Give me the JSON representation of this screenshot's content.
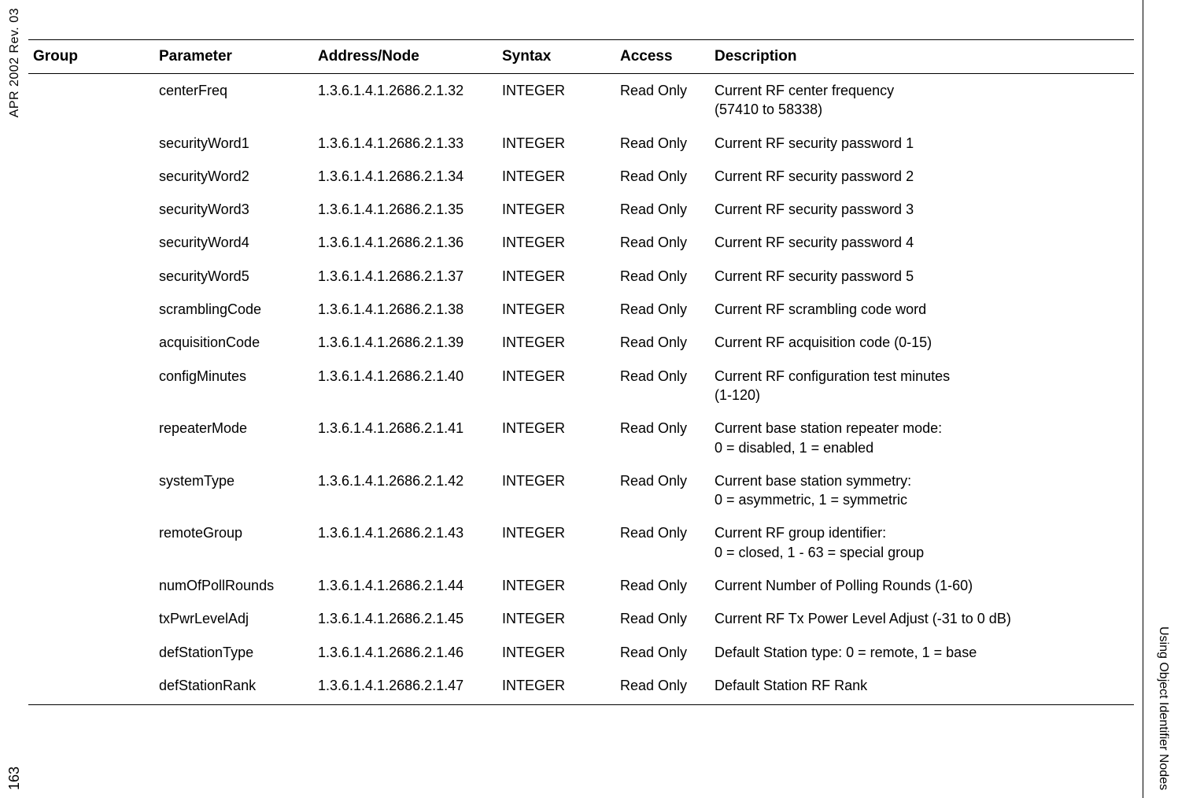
{
  "margin_left_top": "APR 2002 Rev. 03",
  "margin_left_bottom": "163",
  "margin_right": "Using Object Identifier Nodes",
  "chart_data": {
    "type": "table",
    "title": "",
    "columns": [
      "Group",
      "Parameter",
      "Address/Node",
      "Syntax",
      "Access",
      "Description"
    ]
  },
  "headers": {
    "group": "Group",
    "parameter": "Parameter",
    "address": "Address/Node",
    "syntax": "Syntax",
    "access": "Access",
    "description": "Description"
  },
  "rows": [
    {
      "group": "",
      "parameter": "centerFreq",
      "address": "1.3.6.1.4.1.2686.2.1.32",
      "syntax": "INTEGER",
      "access": "Read Only",
      "description": "Current RF center frequency\n (57410 to 58338)"
    },
    {
      "group": "",
      "parameter": "securityWord1",
      "address": "1.3.6.1.4.1.2686.2.1.33",
      "syntax": "INTEGER",
      "access": "Read Only",
      "description": "Current RF security password 1"
    },
    {
      "group": "",
      "parameter": "securityWord2",
      "address": "1.3.6.1.4.1.2686.2.1.34",
      "syntax": "INTEGER",
      "access": "Read Only",
      "description": "Current RF security password 2"
    },
    {
      "group": "",
      "parameter": "securityWord3",
      "address": "1.3.6.1.4.1.2686.2.1.35",
      "syntax": "INTEGER",
      "access": "Read Only",
      "description": "Current RF security password 3"
    },
    {
      "group": "",
      "parameter": "securityWord4",
      "address": "1.3.6.1.4.1.2686.2.1.36",
      "syntax": "INTEGER",
      "access": "Read Only",
      "description": "Current RF security password 4"
    },
    {
      "group": "",
      "parameter": "securityWord5",
      "address": "1.3.6.1.4.1.2686.2.1.37",
      "syntax": "INTEGER",
      "access": "Read Only",
      "description": "Current RF security password 5"
    },
    {
      "group": "",
      "parameter": "scramblingCode",
      "address": "1.3.6.1.4.1.2686.2.1.38",
      "syntax": "INTEGER",
      "access": "Read Only",
      "description": "Current RF scrambling code word"
    },
    {
      "group": "",
      "parameter": "acquisitionCode",
      "address": "1.3.6.1.4.1.2686.2.1.39",
      "syntax": "INTEGER",
      "access": "Read Only",
      "description": "Current RF acquisition code (0-15)"
    },
    {
      "group": "",
      "parameter": "configMinutes",
      "address": "1.3.6.1.4.1.2686.2.1.40",
      "syntax": "INTEGER",
      "access": "Read Only",
      "description": "Current RF configuration test minutes\n (1-120)"
    },
    {
      "group": "",
      "parameter": "repeaterMode",
      "address": "1.3.6.1.4.1.2686.2.1.41",
      "syntax": "INTEGER",
      "access": "Read Only",
      "description": "Current base station repeater mode:\n 0 = disabled, 1 = enabled"
    },
    {
      "group": "",
      "parameter": "systemType",
      "address": "1.3.6.1.4.1.2686.2.1.42",
      "syntax": "INTEGER",
      "access": "Read Only",
      "description": "Current base station symmetry:\n 0 = asymmetric, 1 = symmetric"
    },
    {
      "group": "",
      "parameter": "remoteGroup",
      "address": "1.3.6.1.4.1.2686.2.1.43",
      "syntax": "INTEGER",
      "access": "Read Only",
      "description": "Current RF group identifier:\n 0 = closed, 1 - 63 = special group"
    },
    {
      "group": "",
      "parameter": "numOfPollRounds",
      "address": "1.3.6.1.4.1.2686.2.1.44",
      "syntax": "INTEGER",
      "access": "Read Only",
      "description": "Current Number of Polling Rounds (1-60)"
    },
    {
      "group": "",
      "parameter": "txPwrLevelAdj",
      "address": "1.3.6.1.4.1.2686.2.1.45",
      "syntax": "INTEGER",
      "access": "Read Only",
      "description": "Current RF Tx Power Level Adjust (-31 to 0 dB)"
    },
    {
      "group": "",
      "parameter": "defStationType",
      "address": "1.3.6.1.4.1.2686.2.1.46",
      "syntax": "INTEGER",
      "access": "Read Only",
      "description": "Default Station type: 0 = remote, 1 = base"
    },
    {
      "group": "",
      "parameter": "defStationRank",
      "address": "1.3.6.1.4.1.2686.2.1.47",
      "syntax": "INTEGER",
      "access": "Read Only",
      "description": "Default Station RF Rank"
    }
  ]
}
